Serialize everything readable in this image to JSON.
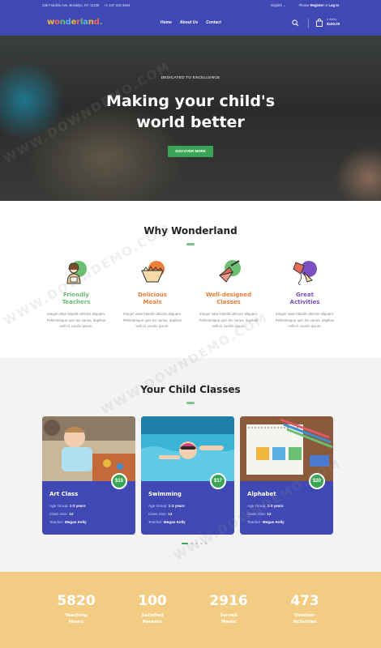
{
  "topbar": {
    "address": "236 Franklin Ave, Brooklyn, NY 11238",
    "phone": "+1 347-318-3644",
    "language": "English",
    "login_prefix": "Please",
    "register": "Register",
    "or": "or",
    "login": "Log In"
  },
  "header": {
    "logo": "wonderland.",
    "nav": [
      "Home",
      "About Us",
      "Contact"
    ],
    "cart_label": "0 items",
    "cart_total": "$100.00"
  },
  "hero": {
    "kicker": "DEDICATED TO EXCELLENCE",
    "title_line1": "Making your child's",
    "title_line2": "world better",
    "button": "DISCOVER MORE"
  },
  "why": {
    "title": "Why Wonderland",
    "features": [
      {
        "title_1": "Friendly",
        "title_2": "Teachers",
        "color": "#6abf73",
        "icon": "teacher-icon",
        "desc_1": "Integer vitae blandit ultricies aliquam.",
        "desc_2": "Pellentesque quis leo varius, dapibus",
        "desc_3": "velit id, iaculis ipsum."
      },
      {
        "title_1": "Delicious",
        "title_2": "Meals",
        "color": "#ef7e38",
        "icon": "meal-bowl-icon",
        "desc_1": "Integer vitae blandit ultricies aliquam.",
        "desc_2": "Pellentesque quis leo varius, dapibus",
        "desc_3": "velit id, iaculis ipsum."
      },
      {
        "title_1": "Well-designed",
        "title_2": "Classes",
        "color": "#ef7e38",
        "icon": "trowel-icon",
        "desc_1": "Integer vitae blandit ultricies aliquam.",
        "desc_2": "Pellentesque quis leo varius, dapibus",
        "desc_3": "velit id, iaculis ipsum."
      },
      {
        "title_1": "Great",
        "title_2": "Activities",
        "color": "#7b4fbf",
        "icon": "kite-icon",
        "desc_1": "Integer vitae blandit ultricies aliquam.",
        "desc_2": "Pellentesque quis leo varius, dapibus",
        "desc_3": "velit id, iaculis ipsum."
      }
    ]
  },
  "classes": {
    "title": "Your Child Classes",
    "age_label": "Age Group:",
    "size_label": "Class Size:",
    "teacher_label": "Teacher:",
    "cards": [
      {
        "name": "Art Class",
        "price": "$15",
        "age": "1-3 years",
        "size": "12",
        "teacher": "Megan Kelly"
      },
      {
        "name": "Swimming",
        "price": "$17",
        "age": "1-3 years",
        "size": "12",
        "teacher": "Megan Kelly"
      },
      {
        "name": "Alphabet",
        "price": "$20",
        "age": "1-3 years",
        "size": "12",
        "teacher": "Megan Kelly"
      }
    ]
  },
  "stats": [
    {
      "value": "5820",
      "label_1": "Teaching",
      "label_2": "Hours"
    },
    {
      "value": "100",
      "label_1": "Satisfied",
      "label_2": "Parents"
    },
    {
      "value": "2916",
      "label_1": "Served",
      "label_2": "Meals"
    },
    {
      "value": "473",
      "label_1": "Outdoor",
      "label_2": "Activities"
    }
  ],
  "watermark": "WWW.DOWNDEMO.COM"
}
